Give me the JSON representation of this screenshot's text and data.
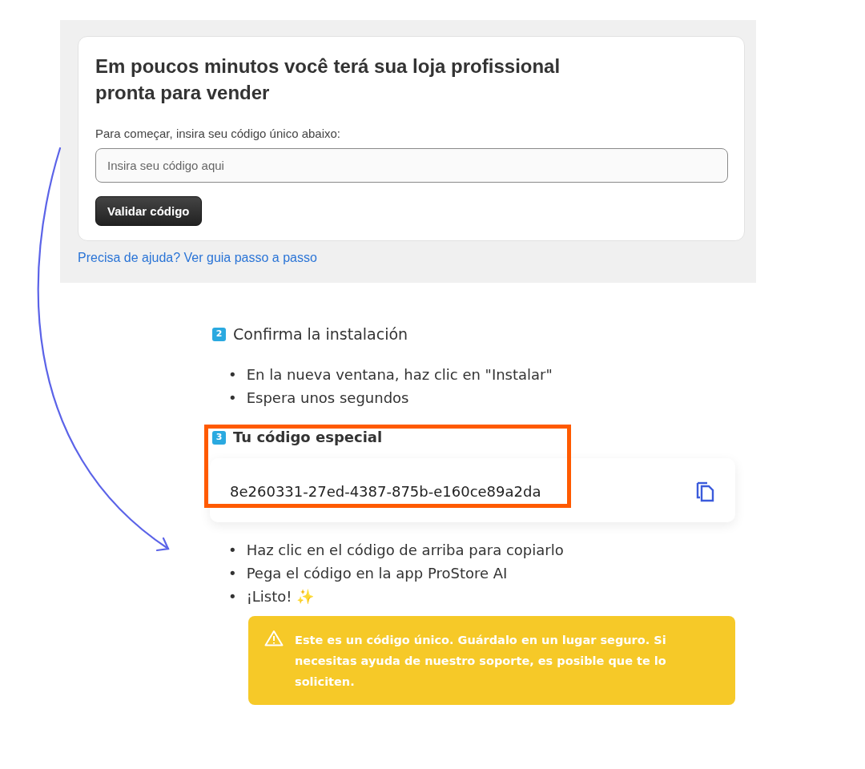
{
  "setup_card": {
    "title": "Em poucos minutos você terá sua loja profissional pronta para vender",
    "prompt": "Para começar, insira seu código único abaixo:",
    "code_field": {
      "placeholder": "Insira seu código aqui"
    },
    "button": "Validar código",
    "help_link": "Precisa de ajuda? Ver guia passo a passo"
  },
  "steps": [
    {
      "number": "2",
      "title": "Confirma la instalación",
      "bold": false,
      "bullets": [
        {
          "marker": "•",
          "text": "En la nueva ventana, haz clic en \"Instalar\""
        },
        {
          "marker": "•",
          "text": "Espera unos segundos"
        }
      ]
    },
    {
      "number": "3",
      "title": "Tu código especial",
      "bold": true,
      "highlighted": true,
      "code": "8e260331-27ed-4387-875b-e160ce89a2da",
      "bullets": [
        {
          "marker": "•",
          "text": "Haz clic en el código de arriba para copiarlo"
        },
        {
          "marker": "•",
          "text": "Pega el código en la app ProStore AI"
        },
        {
          "marker": "•",
          "text": "¡Listo! ✨"
        }
      ],
      "warning": "Este es un código único. Guárdalo en un lugar seguro. Si necesitas ayuda de nuestro soporte, es posible que te lo soliciten."
    }
  ]
}
